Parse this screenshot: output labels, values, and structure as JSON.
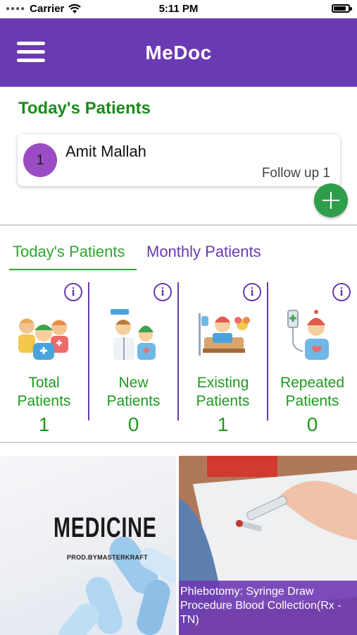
{
  "status_bar": {
    "carrier": "Carrier",
    "time": "5:11 PM"
  },
  "header": {
    "title": "MeDoc"
  },
  "todays_patients": {
    "title": "Today's Patients",
    "patients": [
      {
        "number": "1",
        "name": "Amit Mallah",
        "status": "Follow up 1"
      }
    ]
  },
  "tabs": [
    {
      "label": "Today's Patients",
      "active": true
    },
    {
      "label": "Monthly Patients",
      "active": false
    }
  ],
  "stats": [
    {
      "label_line1": "Total",
      "label_line2": "Patients",
      "value": "1",
      "icon": "patients-group-icon"
    },
    {
      "label_line1": "New",
      "label_line2": "Patients",
      "value": "0",
      "icon": "doctor-patient-icon"
    },
    {
      "label_line1": "Existing",
      "label_line2": "Patients",
      "value": "1",
      "icon": "patient-bed-icon"
    },
    {
      "label_line1": "Repeated",
      "label_line2": "Patients",
      "value": "0",
      "icon": "patient-iv-drip-icon"
    }
  ],
  "media": [
    {
      "title": "MEDICINE",
      "subtitle": "PROD.BYMASTERKRAFT"
    },
    {
      "caption": "Phlebotomy: Syringe Draw Procedure Blood Collection(Rx - TN)"
    }
  ],
  "colors": {
    "brand_purple": "#6a3ab2",
    "accent_green": "#1e8a1e",
    "avatar_purple": "#9b4cc4",
    "fab_green": "#2e9e4a"
  }
}
